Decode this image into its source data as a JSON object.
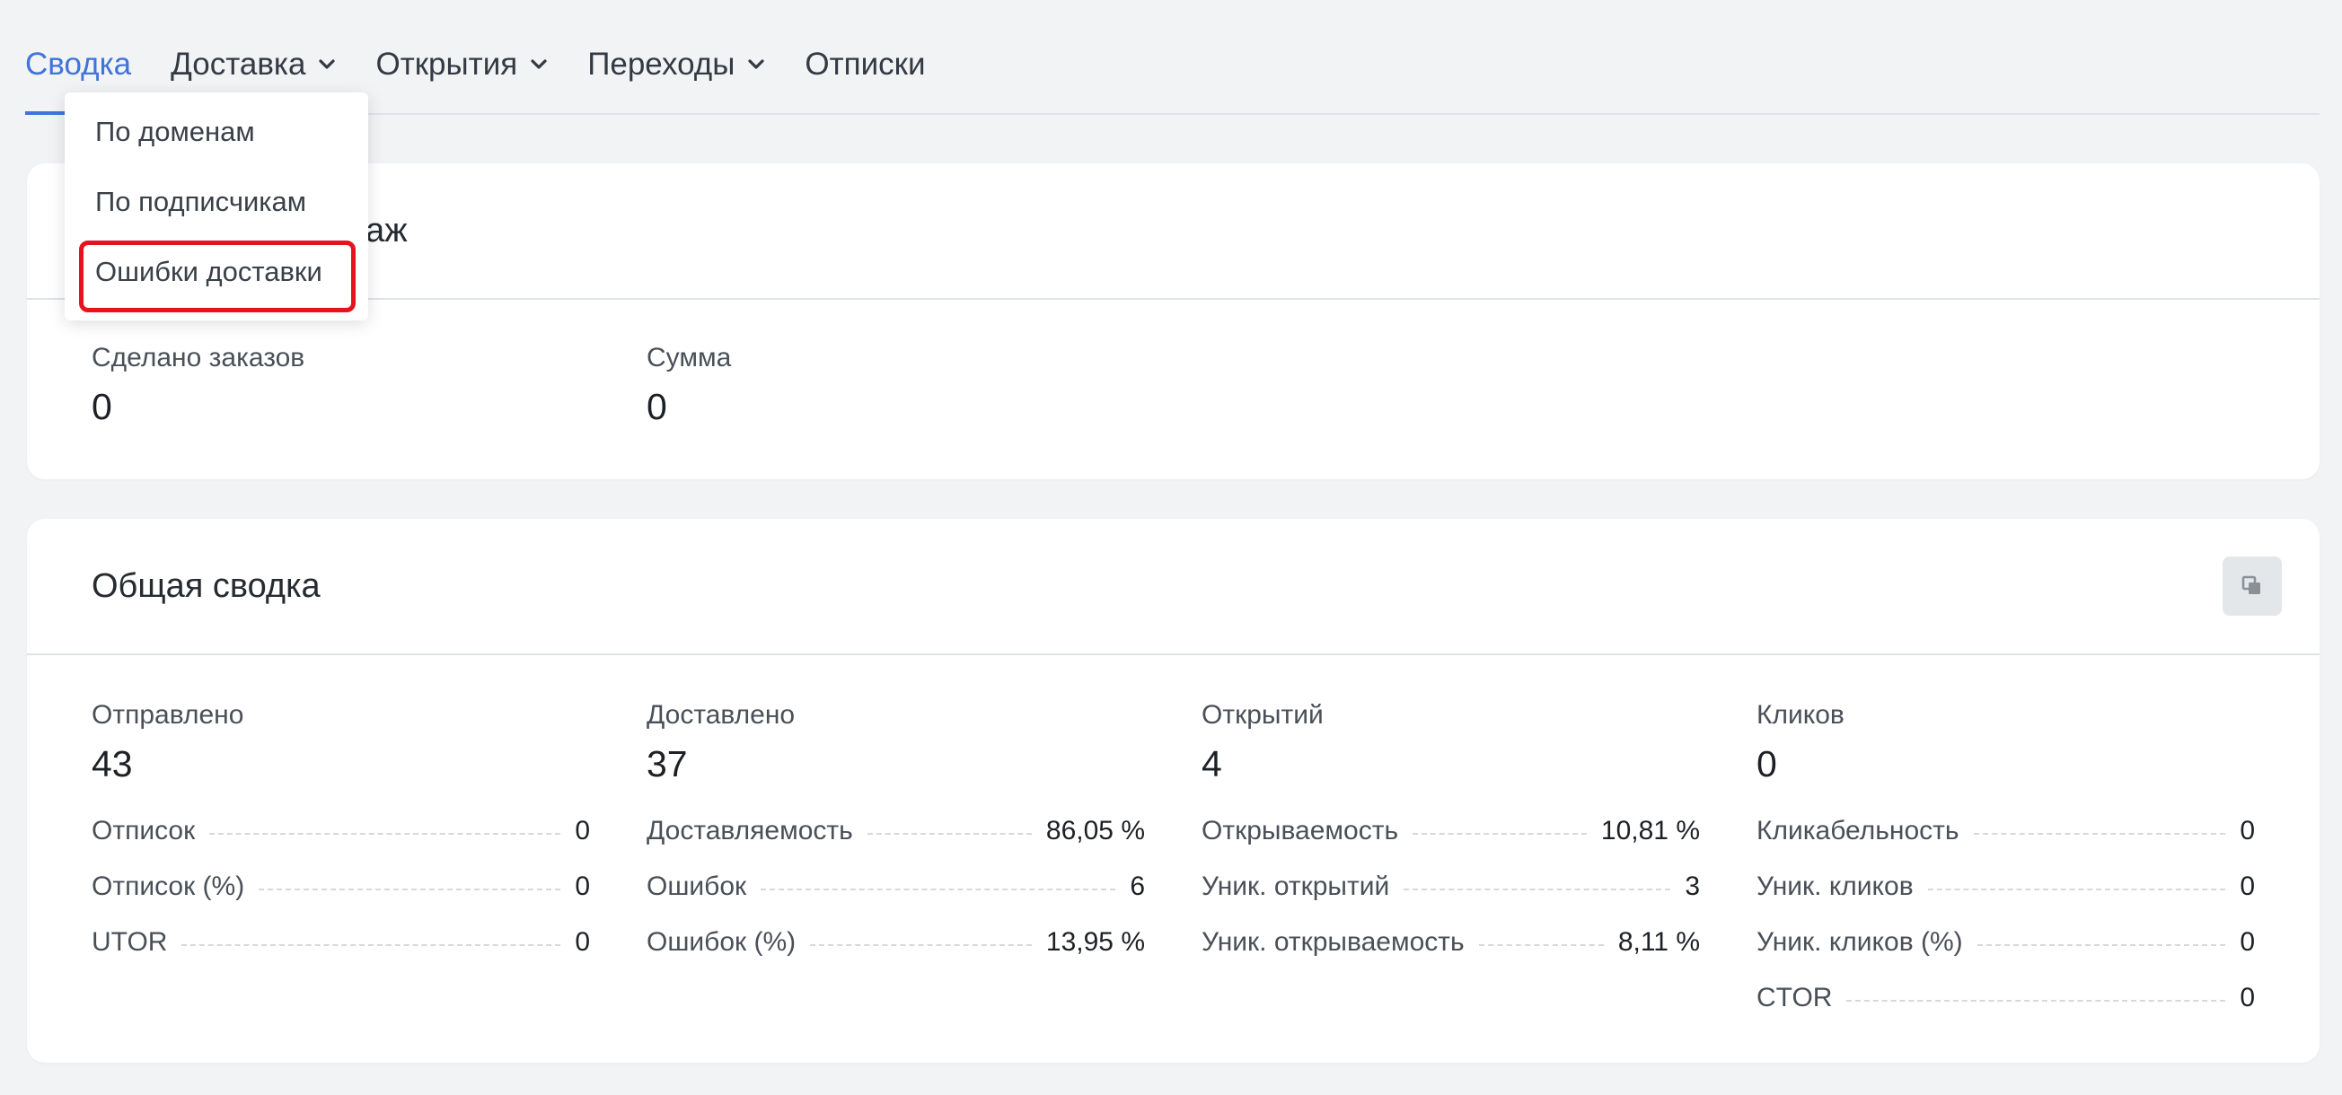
{
  "tabs": [
    {
      "label": "Сводка",
      "active": true,
      "dropdown": false
    },
    {
      "label": "Доставка",
      "active": false,
      "dropdown": true
    },
    {
      "label": "Открытия",
      "active": false,
      "dropdown": true
    },
    {
      "label": "Переходы",
      "active": false,
      "dropdown": true
    },
    {
      "label": "Отписки",
      "active": false,
      "dropdown": false
    }
  ],
  "dropdown": {
    "items": [
      "По доменам",
      "По подписчикам",
      "Ошибки доставки"
    ],
    "highlighted_item": "Ошибки доставки",
    "highlight_color": "#e5141c"
  },
  "sales_card": {
    "title_visible_fragment": "даж",
    "metrics": [
      {
        "label": "Сделано заказов",
        "value": "0"
      },
      {
        "label": "Сумма",
        "value": "0"
      }
    ]
  },
  "summary_card": {
    "title": "Общая сводка",
    "copy_icon": "copy-icon",
    "columns": [
      {
        "label": "Отправлено",
        "value": "43",
        "rows": [
          {
            "label": "Отписок",
            "value": "0"
          },
          {
            "label": "Отписок (%)",
            "value": "0"
          },
          {
            "label": "UTOR",
            "value": "0"
          }
        ]
      },
      {
        "label": "Доставлено",
        "value": "37",
        "rows": [
          {
            "label": "Доставляемость",
            "value": "86,05 %"
          },
          {
            "label": "Ошибок",
            "value": "6"
          },
          {
            "label": "Ошибок (%)",
            "value": "13,95 %"
          }
        ]
      },
      {
        "label": "Открытий",
        "value": "4",
        "rows": [
          {
            "label": "Открываемость",
            "value": "10,81 %"
          },
          {
            "label": "Уник. открытий",
            "value": "3"
          },
          {
            "label": "Уник. открываемость",
            "value": "8,11 %"
          }
        ]
      },
      {
        "label": "Кликов",
        "value": "0",
        "rows": [
          {
            "label": "Кликабельность",
            "value": "0"
          },
          {
            "label": "Уник. кликов",
            "value": "0"
          },
          {
            "label": "Уник. кликов (%)",
            "value": "0"
          },
          {
            "label": "CTOR",
            "value": "0"
          }
        ]
      }
    ]
  },
  "colors": {
    "accent": "#3f74d8",
    "background": "#f2f3f5",
    "card": "#ffffff"
  }
}
